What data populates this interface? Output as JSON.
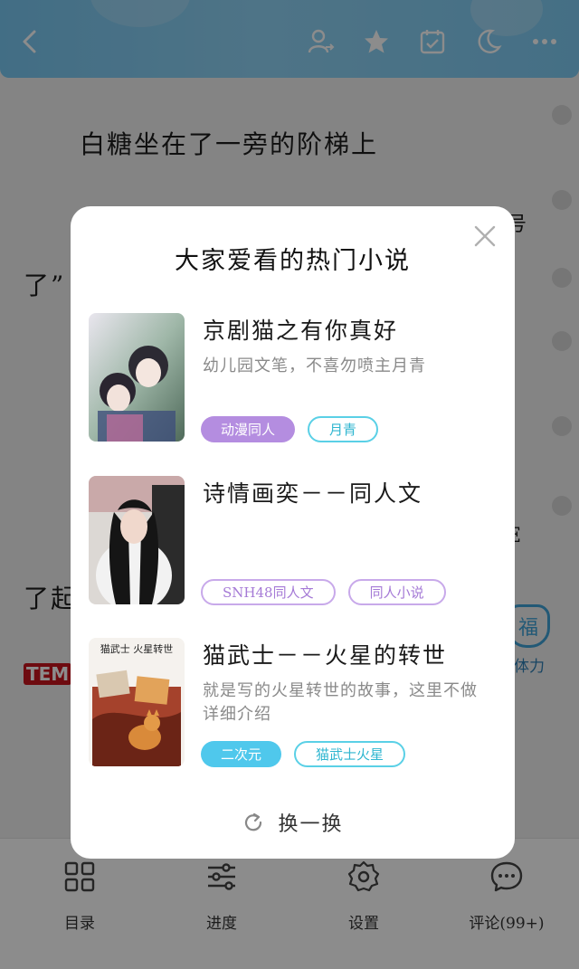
{
  "reader": {
    "lines": [
      "白糖坐在了一旁的阶梯上",
      "了”",
      "了起",
      "号",
      "E"
    ],
    "logo_text": "TEM",
    "fu_badge": "福",
    "fu_label": "体力"
  },
  "topbar": {
    "icons": [
      "back-icon",
      "user-switch-icon",
      "star-icon",
      "calendar-check-icon",
      "moon-icon",
      "more-icon"
    ],
    "color": "#7ecbf3"
  },
  "bottom_nav": [
    {
      "label": "目录",
      "icon": "catalog-grid-icon"
    },
    {
      "label": "进度",
      "icon": "progress-sliders-icon"
    },
    {
      "label": "设置",
      "icon": "settings-gear-icon"
    },
    {
      "label": "评论(99+)",
      "icon": "comment-bubble-icon"
    }
  ],
  "modal": {
    "title": "大家爱看的热门小说",
    "refresh_label": "换一换",
    "books": [
      {
        "title": "京剧猫之有你真好",
        "desc": "幼儿园文笔，不喜勿喷主月青",
        "tags": [
          {
            "label": "动漫同人",
            "style": "fill-purple"
          },
          {
            "label": "月青",
            "style": "line-cyan"
          }
        ]
      },
      {
        "title": "诗情画奕－－同人文",
        "desc": "",
        "tags": [
          {
            "label": "SNH48同人文",
            "style": "line-purple"
          },
          {
            "label": "同人小说",
            "style": "line-purple"
          }
        ]
      },
      {
        "title": "猫武士－－火星的转世",
        "desc": "就是写的火星转世的故事，这里不做详细介绍",
        "cover_text": "猫武士 火星转世",
        "tags": [
          {
            "label": "二次元",
            "style": "fill-cyan"
          },
          {
            "label": "猫武士火星",
            "style": "line-cyan"
          }
        ]
      }
    ]
  },
  "colors": {
    "accent_purple": "#b48de0",
    "accent_cyan": "#4fc8ec"
  }
}
